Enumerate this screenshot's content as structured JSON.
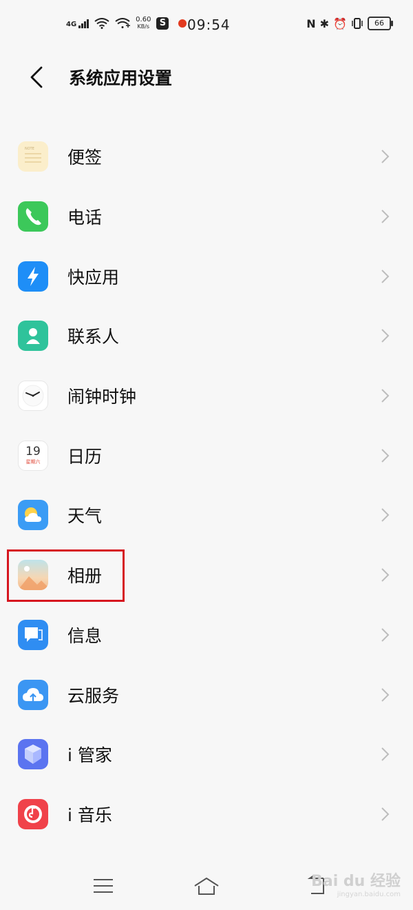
{
  "status_bar": {
    "network": "4G",
    "speed_value": "0.60",
    "speed_unit": "KB/s",
    "time": "09:54",
    "battery": "66",
    "icons": [
      "signal-icon",
      "wifi-icon",
      "wifi-plus-icon",
      "app-s-icon",
      "notification-dot-icon",
      "nfc-icon",
      "bluetooth-icon",
      "alarm-icon",
      "vibrate-icon",
      "battery-icon"
    ]
  },
  "header": {
    "title": "系统应用设置"
  },
  "apps": [
    {
      "label": "便签",
      "icon": "notes-icon",
      "color": "#fbeecb"
    },
    {
      "label": "电话",
      "icon": "phone-icon",
      "color": "#3cc85a"
    },
    {
      "label": "快应用",
      "icon": "quick-app-icon",
      "color": "#1e8ef7"
    },
    {
      "label": "联系人",
      "icon": "contacts-icon",
      "color": "#2fc39b"
    },
    {
      "label": "闹钟时钟",
      "icon": "clock-icon",
      "color": "#ffffff"
    },
    {
      "label": "日历",
      "icon": "calendar-icon",
      "color": "#ffffff",
      "day": "19",
      "weekday": "星期六"
    },
    {
      "label": "天气",
      "icon": "weather-icon",
      "color": "#3b9cf5"
    },
    {
      "label": "相册",
      "icon": "album-icon",
      "color": "#f6c99a"
    },
    {
      "label": "信息",
      "icon": "messages-icon",
      "color": "#2f8df2"
    },
    {
      "label": "云服务",
      "icon": "cloud-icon",
      "color": "#3b96f3"
    },
    {
      "label": "i 管家",
      "icon": "i-manager-icon",
      "color": "#5b74f0"
    },
    {
      "label": "i 音乐",
      "icon": "i-music-icon",
      "color": "#f0424a"
    }
  ],
  "highlight_color": "#d6161f",
  "navbar": {
    "watermark_main": "Bai du 经验",
    "watermark_sub": "jingyan.baidu.com"
  }
}
